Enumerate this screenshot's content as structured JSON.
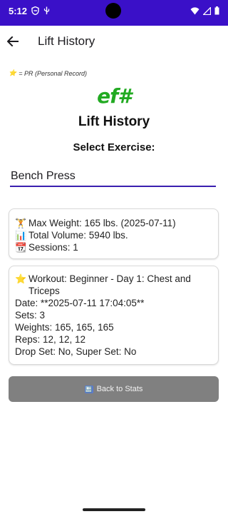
{
  "status_bar": {
    "time": "5:12",
    "icons_left": [
      "shield-icon",
      "usb-icon"
    ],
    "icons_right": [
      "wifi-icon",
      "signal-icon",
      "battery-icon"
    ],
    "color": "#3a10c8"
  },
  "app_bar": {
    "title": "Lift History",
    "back_icon": "arrow-left-icon"
  },
  "pr_legend": {
    "icon": "⭐",
    "text": "= PR (Personal Record)"
  },
  "logo": {
    "text": "ef#",
    "color": "#22aa22"
  },
  "page_title": "Lift History",
  "select_label": "Select Exercise:",
  "exercise_input": {
    "value": "Bench Press"
  },
  "stats": {
    "max_weight_icon": "🏋",
    "max_weight": "Max Weight: 165 lbs. (2025-07-11)",
    "total_volume_icon": "📊",
    "total_volume": "Total Volume: 5940 lbs.",
    "sessions_icon": "📆",
    "sessions": "Sessions: 1"
  },
  "workout": {
    "icon": "⭐",
    "title": "Workout: Beginner - Day 1: Chest and Triceps",
    "date": "Date: **2025-07-11 17:04:05**",
    "sets": "Sets: 3",
    "weights": "Weights: 165, 165, 165",
    "reps": "Reps: 12, 12, 12",
    "flags": "Drop Set: No, Super Set: No"
  },
  "back_button": {
    "icon": "🔙",
    "label": "Back to Stats",
    "color": "#808080"
  }
}
